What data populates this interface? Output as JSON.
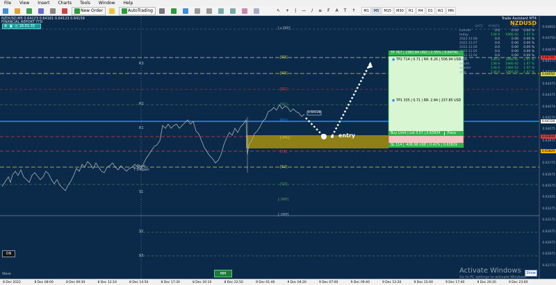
{
  "menu": [
    "File",
    "View",
    "Insert",
    "Charts",
    "Tools",
    "Window",
    "Help"
  ],
  "toolbar": {
    "new_order": "New Order",
    "autotrading": "AutoTrading",
    "timeframes": [
      "M1",
      "M5",
      "M15",
      "M30",
      "H1",
      "H4",
      "D1",
      "W1",
      "MN"
    ],
    "active_timeframe": "M5"
  },
  "chart_header": {
    "symbol_line": "NZDUSD,M5  0.64123 0.64161 0.64123 0.64159",
    "report_line": "FINANCIAL REPORT YTD",
    "timer": "16:01:33"
  },
  "trade_assistant": {
    "title": "Trade Assistant MT4",
    "symbol": "NZDUSD",
    "columns": [
      "DATE",
      "POINTS",
      "PIPS",
      "%"
    ],
    "rows": [
      {
        "label": "current",
        "points": "0.0",
        "pips": "0.00",
        "pct": "0.00 %"
      },
      {
        "label": "today",
        "points": "136.9",
        "pips": "1966.92",
        "pct": "1.97 %"
      },
      {
        "label": "2022.12.08",
        "points": "0.0",
        "pips": "0.00",
        "pct": "0.00 %"
      },
      {
        "label": "2022.12.07",
        "points": "0.0",
        "pips": "0.00",
        "pct": "0.00 %"
      },
      {
        "label": "2022.12.06",
        "points": "0.0",
        "pips": "0.00",
        "pct": "0.00 %"
      },
      {
        "label": "2022.12.05",
        "points": "0.0",
        "pips": "0.00",
        "pct": "0.00 %"
      },
      {
        "label": "2022.12.04",
        "points": "0.0",
        "pips": "0.00",
        "pct": "0.00 %"
      },
      {
        "label": "week",
        "points": "136.9",
        "pips": "1966.92",
        "pct": "1.97 %"
      },
      {
        "label": "month",
        "points": "136.9",
        "pips": "1966.92",
        "pct": "1.97 %"
      },
      {
        "label": "quarter",
        "points": "136.9",
        "pips": "1966.92",
        "pct": "1.97 %"
      },
      {
        "label": "year",
        "points": "136.9",
        "pips": "1966.92",
        "pct": "1.97 %"
      }
    ]
  },
  "trade": {
    "tp2": "TP2 714 | 0.71 | RR: 6.26 | 506.94 USD",
    "tp_top": "TP 767 | 2383.84 USD | 2.35% | 0.64791",
    "tp1": "TP1 335 | 0.71 | RR: 2.84 | 237.85 USD",
    "buy_limit": "Buy Limit | Lot 3.57 | 0.63934",
    "place": "Place",
    "sl": "SL 114 | -406.98 USD | 0.42% | 0.63829",
    "entry_note": "entry",
    "price_flag": "0.64128"
  },
  "levels": {
    "pivot_labels": [
      "[+2RP]",
      "[R3]",
      "[R3]",
      "[R2]",
      "[R1]",
      "[R1]",
      "[-0%]",
      "[S1]",
      "[S2]",
      "[S3]",
      "[-2RP]",
      "[-3RP]"
    ],
    "side_labels": [
      "R3",
      "R2",
      "R1",
      "Pivot",
      "T'S Open",
      "S1",
      "S2",
      "S3"
    ]
  },
  "price_axis": [
    "0.64810",
    "0.64750",
    "0.64679",
    "0.64575",
    "0.64550",
    "0.64475",
    "0.64375",
    "0.64274",
    "0.64175",
    "0.64075",
    "0.63975",
    "0.63875",
    "0.63775",
    "0.63675",
    "0.63575",
    "0.63425",
    "0.63275",
    "0.63175",
    "0.63075",
    "0.62975",
    "0.62875",
    "0.62775"
  ],
  "price_tags": [
    {
      "text": "0.64791",
      "color": "#e33b3b"
    },
    {
      "text": "0.64650",
      "color": "#d8d247"
    },
    {
      "text": "0.64128",
      "color": "#ffffff"
    },
    {
      "text": "0.63934",
      "color": "#e33b3b"
    },
    {
      "text": "0.63829",
      "color": "#ffb000"
    }
  ],
  "time_axis": [
    "8 Dec 2022",
    "8 Dec 08:00",
    "8 Dec 09:30",
    "8 Dec 12:10",
    "8 Dec 14:50",
    "8 Dec 17:30",
    "8 Dec 20:10",
    "8 Dec 22:50",
    "9 Dec 01:40",
    "9 Dec 04:20",
    "9 Dec 07:00",
    "9 Dec 09:40",
    "9 Dec 12:20",
    "9 Dec 15:00",
    "9 Dec 17:40",
    "9 Dec 20:20",
    "9 Dec 23:00"
  ],
  "buttons": {
    "on": "ON",
    "mm": "MM",
    "show": "Show"
  },
  "status": {
    "left": "Steve"
  },
  "watermark": {
    "line1": "Activate Windows",
    "line2": "Go to PC settings to activate Windows."
  },
  "colors": {
    "background": "#0b2a4a",
    "bid_line": "#1e90ff",
    "tp_zone": "#d9f6d2",
    "sl_zone": "#f8c4c6",
    "entry_zone": "#9a8a11"
  }
}
